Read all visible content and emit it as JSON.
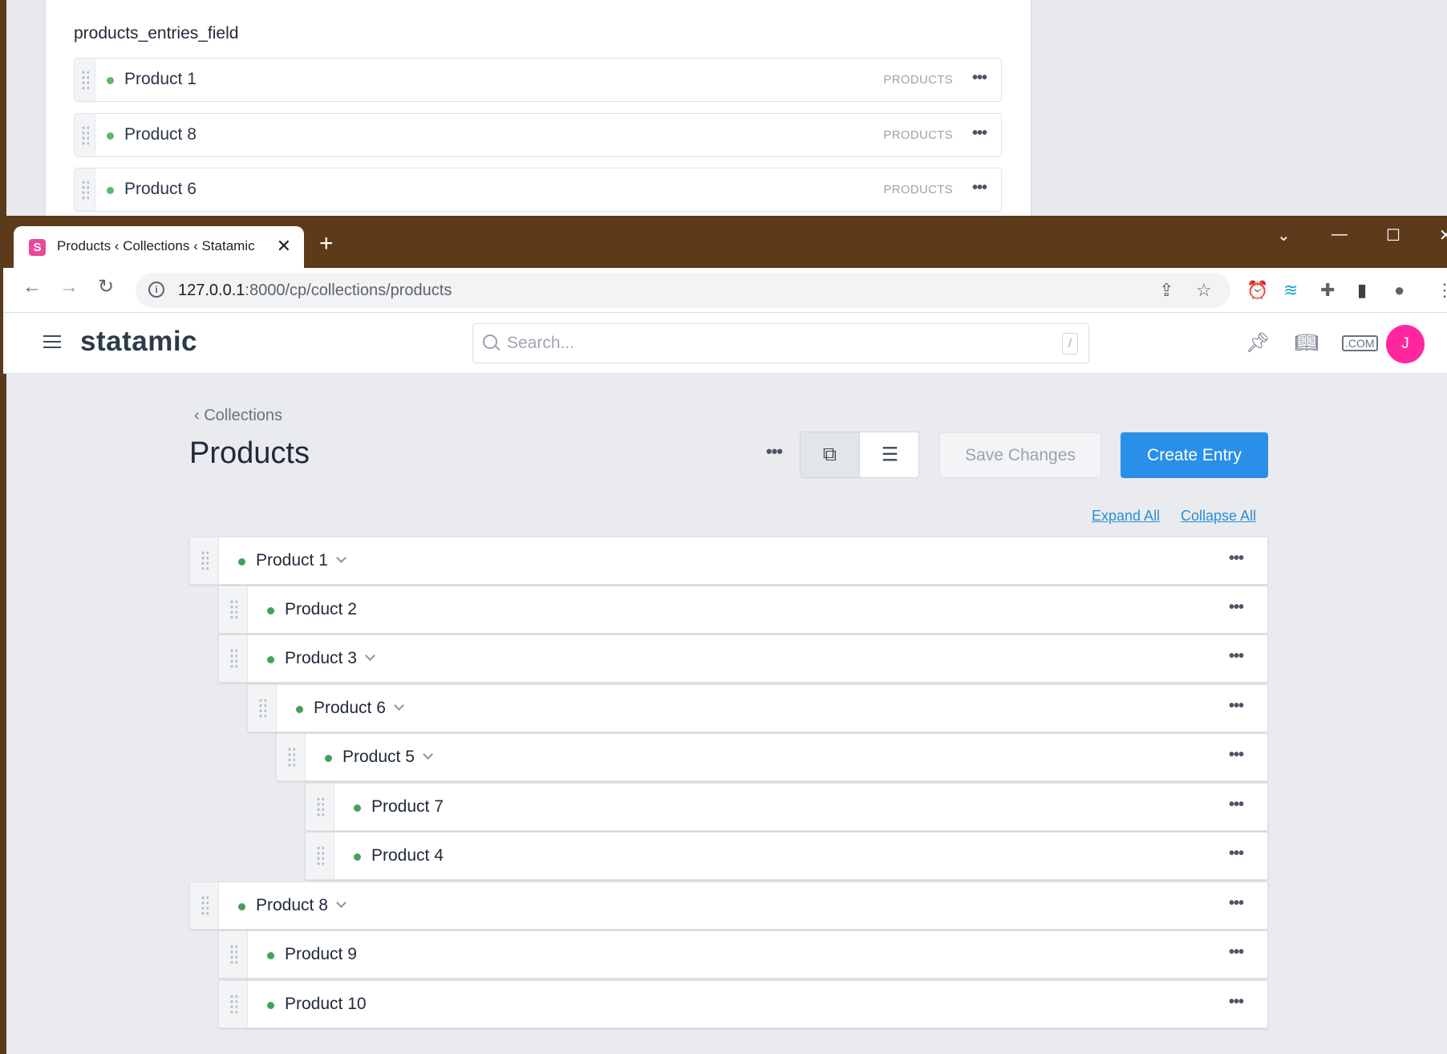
{
  "background_window": {
    "field_title": "products_entries_field",
    "rows": [
      {
        "label": "Product 1",
        "tag": "PRODUCTS"
      },
      {
        "label": "Product 8",
        "tag": "PRODUCTS"
      },
      {
        "label": "Product 6",
        "tag": "PRODUCTS"
      }
    ],
    "more_glyph": "•••"
  },
  "browser": {
    "tab_title": "Products ‹ Collections ‹ Statamic",
    "favicon_letter": "S",
    "url_host": "127.0.0.1",
    "url_path": ":8000/cp/collections/products"
  },
  "header": {
    "brand": "statamic",
    "search_placeholder": "Search...",
    "search_shortcut": "/",
    "avatar_initial": "J"
  },
  "page": {
    "breadcrumb": "‹ Collections",
    "title": "Products",
    "save_label": "Save Changes",
    "create_label": "Create Entry",
    "expand_all": "Expand All",
    "collapse_all": "Collapse All"
  },
  "tree": [
    {
      "label": "Product 1",
      "depth": 0,
      "expandable": true
    },
    {
      "label": "Product 2",
      "depth": 1,
      "expandable": false
    },
    {
      "label": "Product 3",
      "depth": 1,
      "expandable": true
    },
    {
      "label": "Product 6",
      "depth": 2,
      "expandable": true
    },
    {
      "label": "Product 5",
      "depth": 3,
      "expandable": true
    },
    {
      "label": "Product 7",
      "depth": 4,
      "expandable": false
    },
    {
      "label": "Product 4",
      "depth": 4,
      "expandable": false
    },
    {
      "label": "Product 8",
      "depth": 0,
      "expandable": true
    },
    {
      "label": "Product 9",
      "depth": 1,
      "expandable": false
    },
    {
      "label": "Product 10",
      "depth": 1,
      "expandable": false
    }
  ],
  "colors": {
    "published_dot": "#46a05a",
    "primary_button": "#2a8fe8",
    "avatar": "#ff269e",
    "titlebar": "#5c3a1a"
  }
}
